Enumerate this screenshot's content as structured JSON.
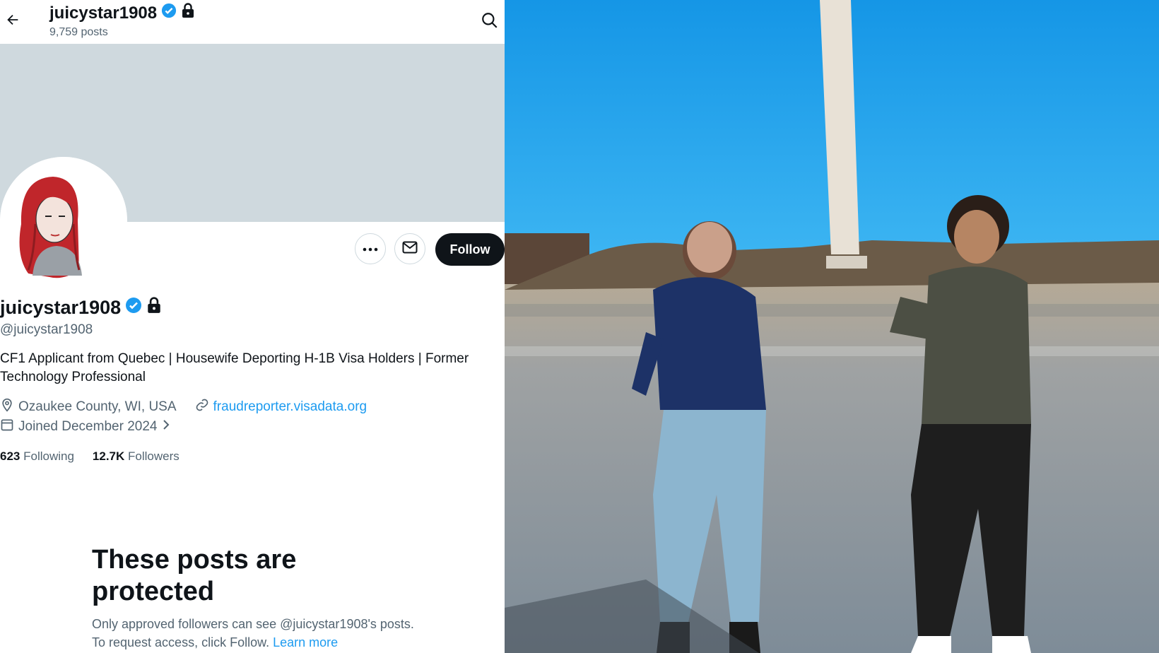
{
  "header": {
    "title": "juicystar1908",
    "post_count": "9,759 posts"
  },
  "profile": {
    "display_name": "juicystar1908",
    "handle": "@juicystar1908",
    "bio": "CF1 Applicant from Quebec | Housewife Deporting H-1B Visa Holders | Former Technology Professional",
    "location": "Ozaukee County, WI, USA",
    "website": "fraudreporter.visadata.org",
    "joined": "Joined December 2024",
    "following_count": "623",
    "following_label": "Following",
    "followers_count": "12.7K",
    "followers_label": "Followers"
  },
  "actions": {
    "follow_label": "Follow"
  },
  "protected": {
    "title": "These posts are protected",
    "text": "Only approved followers can see @juicystar1908's posts. To request access, click Follow.",
    "learn_more": "Learn more"
  },
  "icons": {
    "back": "back-arrow-icon",
    "search": "search-icon",
    "verified": "verified-badge-icon",
    "lock": "lock-icon",
    "more": "more-icon",
    "message": "mail-icon",
    "location": "location-pin-icon",
    "link": "link-icon",
    "calendar": "calendar-icon",
    "chevron": "chevron-right-icon"
  },
  "colors": {
    "accent": "#1d9bf0",
    "banner": "#cfd9de",
    "text": "#0f1419",
    "muted": "#536471"
  }
}
